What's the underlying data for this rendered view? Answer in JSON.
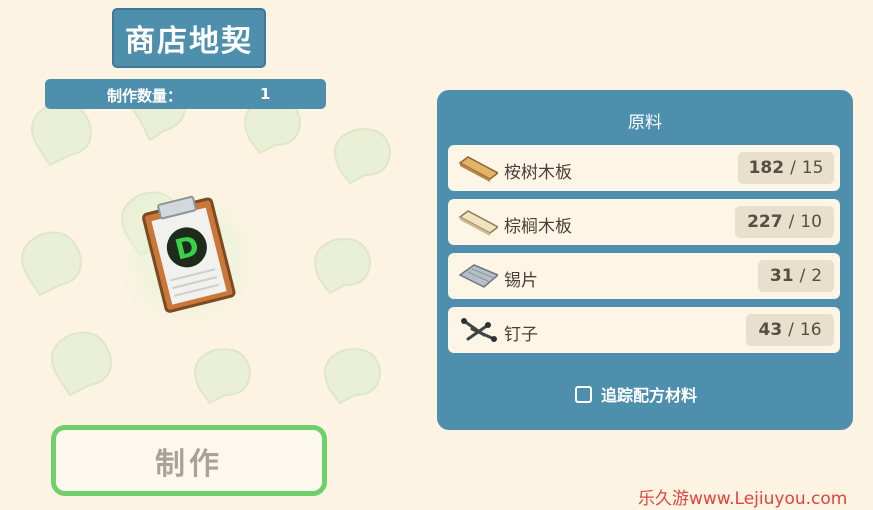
{
  "title": "商店地契",
  "quantity": {
    "label": "制作数量：",
    "value": "1"
  },
  "item": {
    "icon": "deed-clipboard-icon",
    "badge_glyph": "D",
    "accent": "#3ad04a"
  },
  "craft_button": {
    "label": "制作"
  },
  "materials_panel": {
    "title": "原料",
    "items": [
      {
        "name": "桉树木板",
        "have": "182",
        "need": "15",
        "icon": "eucalyptus-plank-icon"
      },
      {
        "name": "棕榈木板",
        "have": "227",
        "need": "10",
        "icon": "palm-plank-icon"
      },
      {
        "name": "锡片",
        "have": "31",
        "need": "2",
        "icon": "tin-sheet-icon"
      },
      {
        "name": "钉子",
        "have": "43",
        "need": "16",
        "icon": "nails-icon"
      }
    ],
    "separator": "/",
    "track_label": "追踪配方材料"
  },
  "watermark": "乐久游www.Lejiuyou.com",
  "colors": {
    "panel": "#4f8fae",
    "background": "#fcf3e2",
    "craft_border": "#6fcf6b"
  }
}
